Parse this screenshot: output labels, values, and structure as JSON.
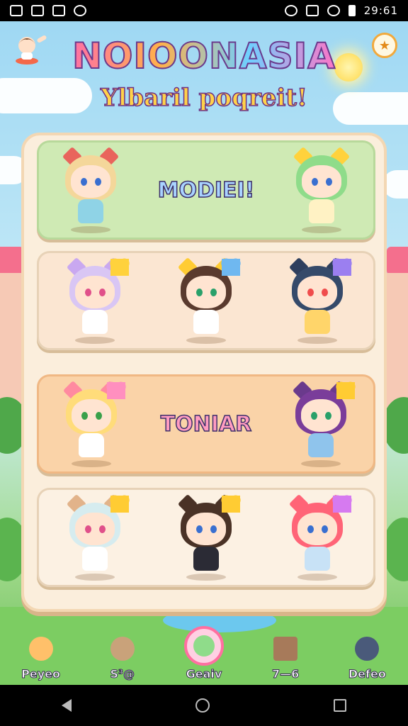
{
  "status_bar": {
    "time": "29:61"
  },
  "header": {
    "title": "NOIOONASIA",
    "subtitle": "Ylbaril poqreit!"
  },
  "rows": [
    {
      "label": "MODIEI!",
      "characters": [
        {
          "hair": "#f4d79a",
          "outfit": "#8fd3e6",
          "ears": "#e9645c",
          "eye": "#3a6fd0"
        },
        {
          "hair": "#8fdc8a",
          "outfit": "#fff2c4",
          "ears": "#ffd23c",
          "eye": "#3a6fd0"
        }
      ]
    },
    {
      "label": "",
      "characters": [
        {
          "hair": "#d9c6f4",
          "outfit": "#ffffff",
          "ears": "#c9a8f0",
          "eye": "#e0508a",
          "heart": "#ffd23c"
        },
        {
          "hair": "#5a3a2e",
          "outfit": "#ffffff",
          "ears": "#ffcc33",
          "eye": "#2aa06a",
          "heart": "#6fb8f0"
        },
        {
          "hair": "#354a6a",
          "outfit": "#ffd56a",
          "ears": "#2e3f5e",
          "eye": "#f04c4c",
          "heart": "#9b7ff0"
        }
      ]
    },
    {
      "label": "TONIAR",
      "characters": [
        {
          "hair": "#ffdc7a",
          "outfit": "#ffffff",
          "ears": "#ff8aa0",
          "eye": "#3aa04a",
          "heart": "#ff8fbf"
        },
        {
          "hair": "#7a3d9a",
          "outfit": "#8fc4ec",
          "ears": "#6a3a8c",
          "eye": "#2aa06a",
          "heart": "#ffcc33"
        }
      ]
    },
    {
      "label": "",
      "characters": [
        {
          "hair": "#d6ecef",
          "outfit": "#ffffff",
          "ears": "#e2b38a",
          "eye": "#e0508a",
          "heart": "#ffcc33"
        },
        {
          "hair": "#4a3226",
          "outfit": "#2b2b35",
          "ears": "#4a3226",
          "eye": "#3a6fd0",
          "heart": "#ffcc33"
        },
        {
          "hair": "#ff6477",
          "outfit": "#c8e2f6",
          "ears": "#ff6477",
          "eye": "#3a6fd0",
          "heart": "#d67af0"
        }
      ]
    }
  ],
  "bottom_nav": [
    {
      "label": "Peyeo",
      "icon": "chibi-orange-icon",
      "color": "#ffc06a"
    },
    {
      "label": "S³@",
      "icon": "critter-icon",
      "color": "#c9a27a"
    },
    {
      "label": "Geaiv",
      "icon": "avatar-circle-icon",
      "color": "#8fdc8a"
    },
    {
      "label": "7—6",
      "icon": "shop-machine-icon",
      "color": "#a77a5a"
    },
    {
      "label": "Defeo",
      "icon": "chibi-dark-icon",
      "color": "#4a5a7a"
    }
  ]
}
